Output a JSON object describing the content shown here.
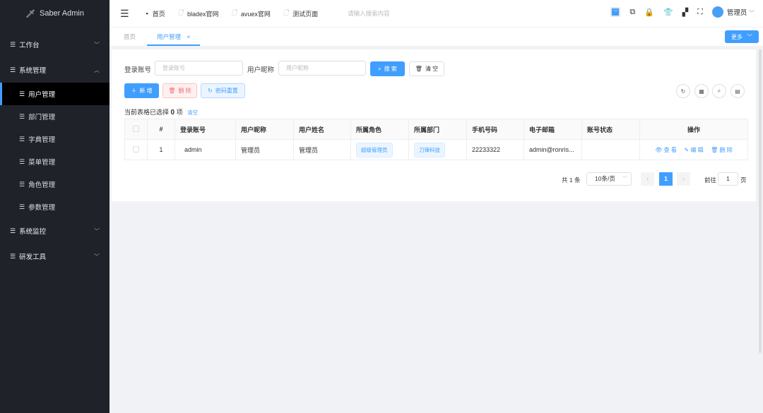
{
  "app": {
    "title": "Saber Admin"
  },
  "sidebar": {
    "items": [
      {
        "label": "工作台",
        "expanded": false
      },
      {
        "label": "系统管理",
        "expanded": true,
        "children": [
          "用户管理",
          "部门管理",
          "字典管理",
          "菜单管理",
          "角色管理",
          "参数管理"
        ],
        "active": "用户管理"
      },
      {
        "label": "系统监控",
        "expanded": false
      },
      {
        "label": "研发工具",
        "expanded": false
      }
    ]
  },
  "header": {
    "nav": [
      "首页",
      "bladex官网",
      "avuex官网",
      "测试页面"
    ],
    "search_placeholder": "请输入搜索内容",
    "user": "管理员"
  },
  "tags": {
    "items": [
      "首页",
      "用户管理"
    ],
    "active": "用户管理",
    "more": "更多"
  },
  "search": {
    "account_label": "登录账号",
    "account_placeholder": "登录账号",
    "nick_label": "用户昵称",
    "nick_placeholder": "用户昵称",
    "search_btn": "搜 索",
    "clear_btn": "清 空"
  },
  "toolbar": {
    "add": "新 增",
    "delete": "删 除",
    "reset_pwd": "密码重置"
  },
  "selection": {
    "prefix": "当前表格已选择",
    "count": "0",
    "suffix": "项",
    "clear": "清空"
  },
  "table": {
    "columns": [
      "#",
      "登录账号",
      "用户昵称",
      "用户姓名",
      "所属角色",
      "所属部门",
      "手机号码",
      "电子邮箱",
      "账号状态",
      "操作"
    ],
    "rows": [
      {
        "index": "1",
        "account": "admin",
        "nick": "管理员",
        "name": "管理员",
        "role": "超级管理员",
        "dept": "刀锋科技",
        "phone": "22233322",
        "email": "admin@ronris...",
        "status": ""
      }
    ],
    "actions": [
      "查 看",
      "编 辑",
      "删 除"
    ]
  },
  "pagination": {
    "total": "共 1 条",
    "page_size": "10条/页",
    "current": "1",
    "goto_label": "前往",
    "goto_value": "1",
    "page_suffix": "页"
  },
  "colors": {
    "primary": "#409eff",
    "sidebar": "#20222a",
    "danger": "#f56c6c"
  }
}
